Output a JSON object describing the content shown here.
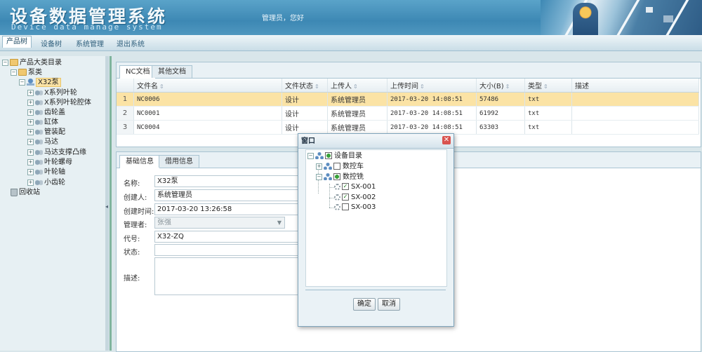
{
  "header": {
    "title": "设备数据管理系统",
    "subtitle": "Device data manage system",
    "welcome": "管理员，您好"
  },
  "topnav": {
    "items": [
      {
        "label": "产品树",
        "active": true
      },
      {
        "label": "设备树"
      },
      {
        "label": "系统管理"
      },
      {
        "label": "退出系统"
      }
    ]
  },
  "tree": {
    "root": "产品大类目录",
    "pump_class": "泵类",
    "selected": "X32泵",
    "children": [
      "X系列叶轮",
      "X系列叶轮腔体",
      "齿轮盖",
      "缸体",
      "管装配",
      "马达",
      "马达支撑凸缘",
      "叶轮螺母",
      "叶轮轴",
      "小齿轮"
    ],
    "recycle": "回收站"
  },
  "docs": {
    "tabs": [
      "NC文档",
      "其他文档"
    ],
    "columns": [
      "文件名",
      "文件状态",
      "上传人",
      "上传时间",
      "大小(B)",
      "类型",
      "描述"
    ],
    "rows": [
      {
        "no": "1",
        "name": "NC0006",
        "status": "设计",
        "uploader": "系统管理员",
        "time": "2017-03-20 14:08:51",
        "size": "57486",
        "type": "txt",
        "desc": ""
      },
      {
        "no": "2",
        "name": "NC0001",
        "status": "设计",
        "uploader": "系统管理员",
        "time": "2017-03-20 14:08:51",
        "size": "61992",
        "type": "txt",
        "desc": ""
      },
      {
        "no": "3",
        "name": "NC0004",
        "status": "设计",
        "uploader": "系统管理员",
        "time": "2017-03-20 14:08:51",
        "size": "63303",
        "type": "txt",
        "desc": ""
      }
    ]
  },
  "info": {
    "tabs": [
      "基础信息",
      "借用信息"
    ],
    "fields": {
      "name_label": "名称:",
      "name_value": "X32泵",
      "creator_label": "创建人:",
      "creator_value": "系统管理员",
      "created_label": "创建时间:",
      "created_value": "2017-03-20 13:26:58",
      "manager_label": "管理者:",
      "manager_value": "张强",
      "code_label": "代号:",
      "code_value": "X32-ZQ",
      "status_label": "状态:",
      "status_value": "",
      "desc_label": "描述:",
      "desc_value": ""
    }
  },
  "modal": {
    "title": "窗口",
    "root": "设备目录",
    "node_lathe": "数控车",
    "node_mill": "数控铣",
    "items": [
      {
        "label": "SX-001",
        "checked": true
      },
      {
        "label": "SX-002",
        "checked": true
      },
      {
        "label": "SX-003",
        "checked": false
      }
    ],
    "confirm": "确定",
    "cancel": "取消"
  }
}
